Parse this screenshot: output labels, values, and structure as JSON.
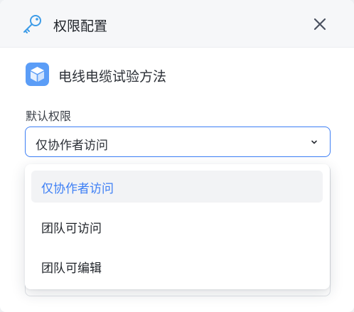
{
  "dialog": {
    "title": "权限配置",
    "title_icon": "key-icon",
    "close_icon": "close-icon"
  },
  "document": {
    "name": "电线电缆试验方法",
    "icon": "cube-icon",
    "icon_color": "#5b9df7"
  },
  "permission": {
    "label": "默认权限",
    "selected_value": "仅协作者访问",
    "accent_color": "#3d7ff5",
    "options": [
      {
        "label": "仅协作者访问",
        "selected": true
      },
      {
        "label": "团队可访问",
        "selected": false
      },
      {
        "label": "团队可编辑",
        "selected": false
      }
    ]
  }
}
